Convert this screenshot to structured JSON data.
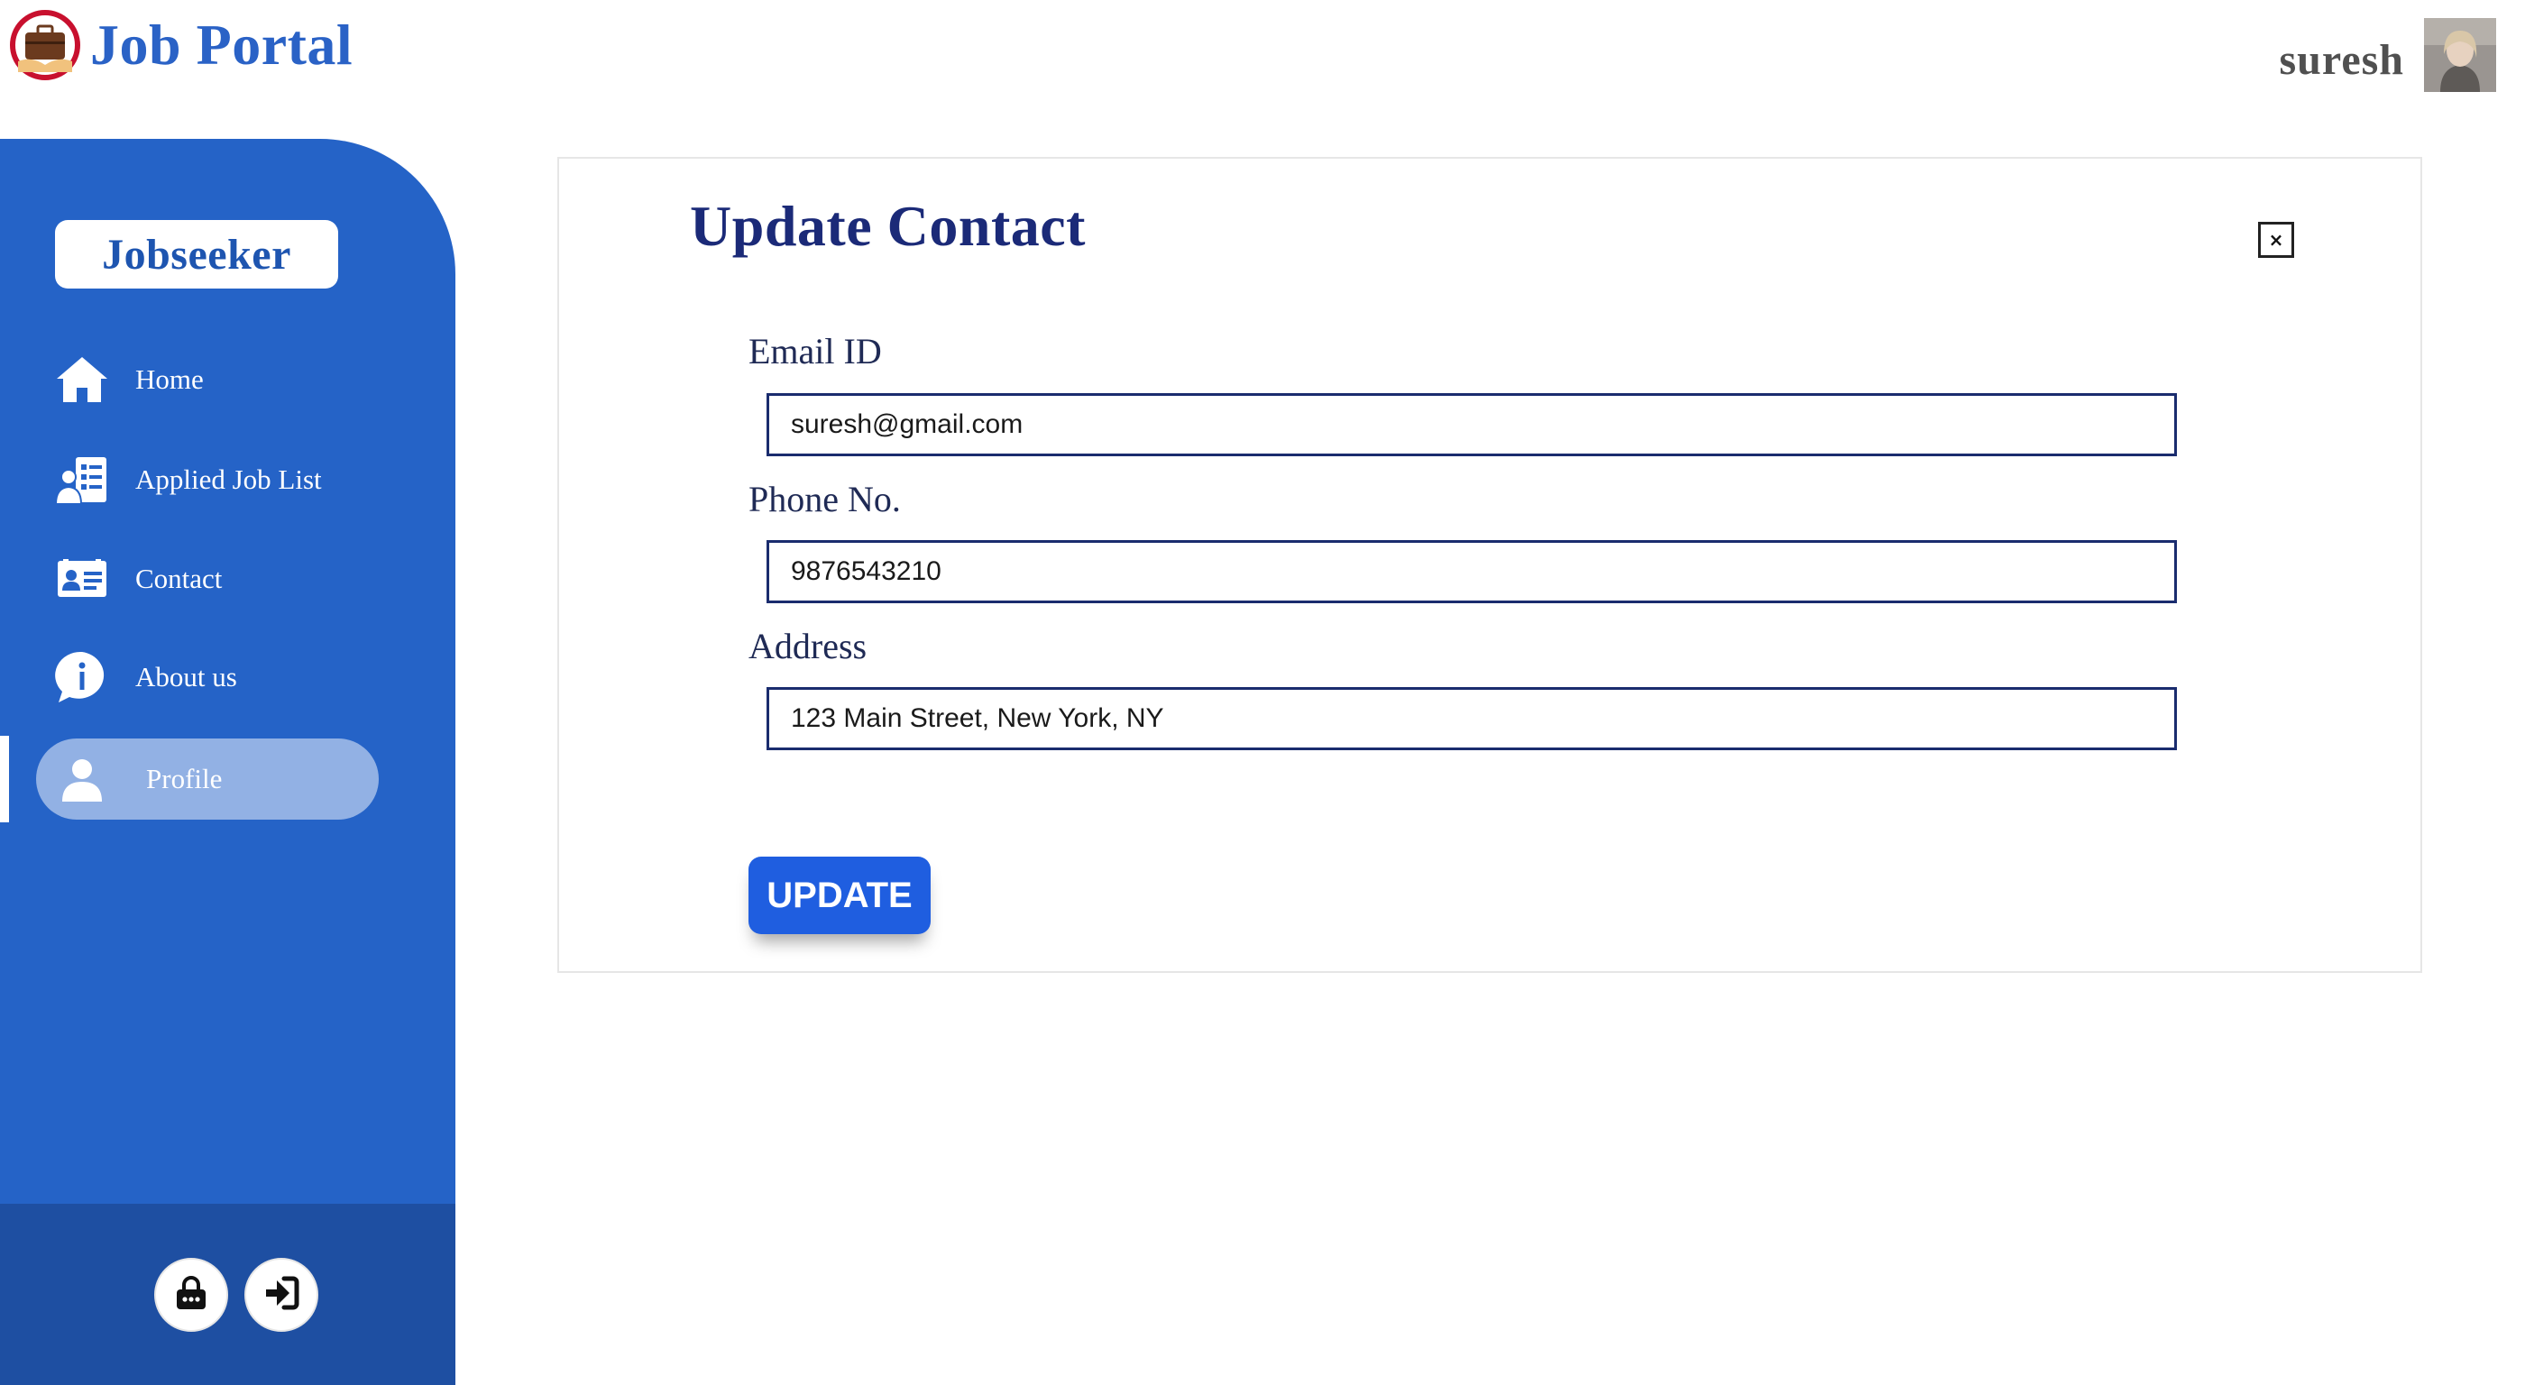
{
  "app": {
    "title": "Job Portal",
    "logo_icon": "briefcase-handshake-logo",
    "brand_color": "#2a62c6"
  },
  "user": {
    "name": "suresh",
    "avatar_icon": "user-avatar-photo"
  },
  "sidebar": {
    "role": "Jobseeker",
    "items": [
      {
        "label": "Home",
        "icon": "home-icon"
      },
      {
        "label": "Applied Job List",
        "icon": "applied-list-icon"
      },
      {
        "label": "Contact",
        "icon": "contact-card-icon"
      },
      {
        "label": "About us",
        "icon": "info-icon"
      },
      {
        "label": "Profile",
        "icon": "user-icon",
        "active": true
      }
    ],
    "footer_buttons": [
      {
        "icon": "lock-icon"
      },
      {
        "icon": "logout-icon"
      }
    ],
    "color": "#2563c7",
    "footer_color": "#1e4fa2"
  },
  "form": {
    "title": "Update Contact",
    "close_label": "×",
    "email_label": "Email ID",
    "email_value": "suresh@gmail.com",
    "phone_label": "Phone No.",
    "phone_value": "9876543210",
    "address_label": "Address",
    "address_value": "123 Main Street, New York, NY",
    "submit_label": "UPDATE",
    "accent_color": "#1f5ee0"
  }
}
